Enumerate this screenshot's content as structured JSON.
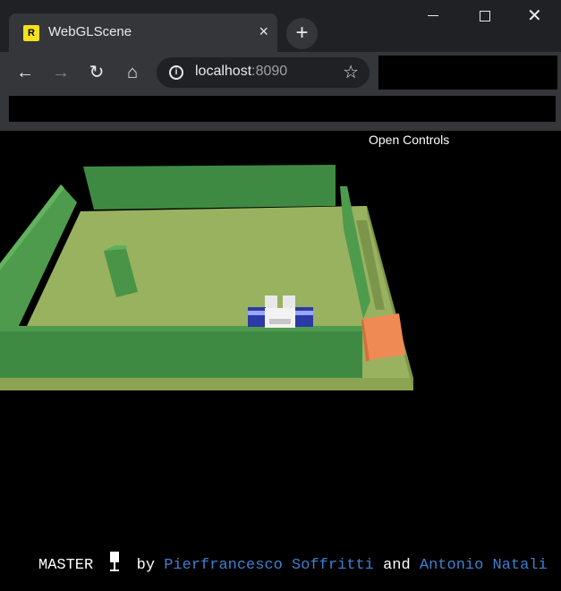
{
  "browser": {
    "tab_title": "WebGLScene",
    "favicon_letter": "R",
    "tab_close": "×",
    "new_tab": "+",
    "url_host": "localhost",
    "url_port": ":8090"
  },
  "page": {
    "open_controls": "Open Controls",
    "footer": {
      "master": "MASTER",
      "by": "by",
      "author1": "Pierfrancesco Soffritti",
      "and": "and",
      "author2": "Antonio Natali"
    }
  },
  "colors": {
    "floor": "#99b25f",
    "wall": "#4f9b4d",
    "obstacle": "#ff8c55",
    "link": "#3f7fd1"
  }
}
